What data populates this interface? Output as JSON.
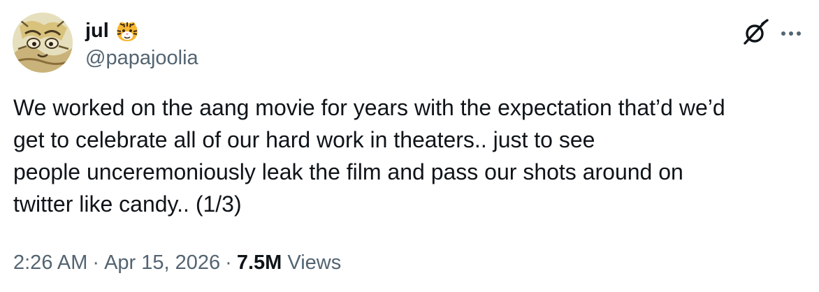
{
  "author": {
    "display_name": "jul",
    "name_emoji": "tiger-face-emoji",
    "handle": "@papajoolia",
    "avatar": "avatar-illustration"
  },
  "actions": {
    "grok_icon": "grok-icon",
    "more_icon": "more-icon"
  },
  "tweet": {
    "lines": [
      "We worked on the aang movie for years with the expectation that’d we’d",
      "get to celebrate all of our hard work in theaters.. just to see",
      "people unceremoniously leak the film and pass our shots around on",
      "twitter like candy.. (1/3)"
    ]
  },
  "meta": {
    "time": "2:26 AM",
    "separator": "·",
    "date": "Apr 15, 2026",
    "views_count": "7.5M",
    "views_label": "Views"
  },
  "colors": {
    "text_primary": "#0f1419",
    "text_secondary": "#536471",
    "background": "#ffffff"
  }
}
